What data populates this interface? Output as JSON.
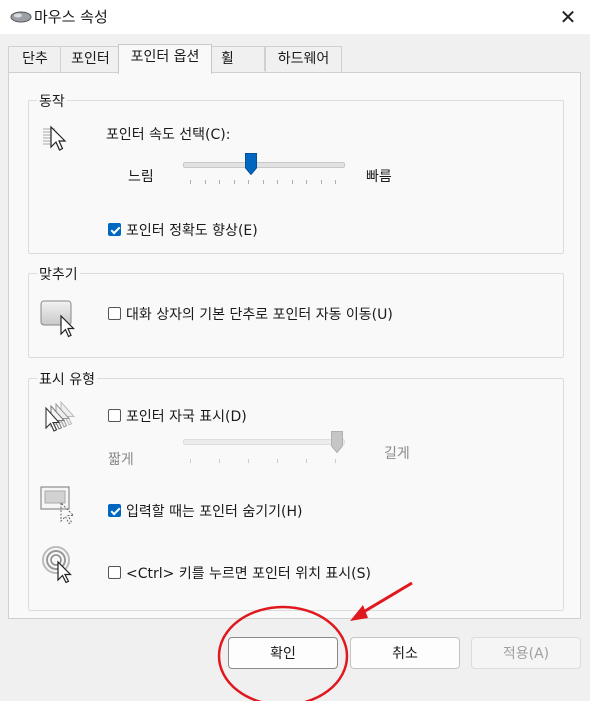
{
  "window": {
    "title": "마우스 속성",
    "close_symbol": "✕"
  },
  "tabs": [
    {
      "label": "단추"
    },
    {
      "label": "포인터"
    },
    {
      "label": "포인터 옵션"
    },
    {
      "label": "휠"
    },
    {
      "label": "하드웨어"
    }
  ],
  "active_tab": "포인터 옵션",
  "motion": {
    "group_title": "동작",
    "speed_label": "포인터 속도 선택(C):",
    "slow_label": "느림",
    "fast_label": "빠름",
    "speed_level": 0.42,
    "precision_label": "포인터 정확도 향상(E)",
    "precision_checked": true
  },
  "snap_to": {
    "group_title": "맞추기",
    "label": "대화 상자의 기본 단추로 포인터 자동 이동(U)",
    "checked": false
  },
  "visibility": {
    "group_title": "표시 유형",
    "trails_label": "포인터 자국 표시(D)",
    "trails_checked": false,
    "short_label": "짧게",
    "long_label": "길게",
    "trail_level": 1.0,
    "hide_typing_label": "입력할 때는 포인터 숨기기(H)",
    "hide_typing_checked": true,
    "ctrl_label": "<Ctrl> 키를 누르면 포인터 위치 표시(S)",
    "ctrl_checked": false
  },
  "buttons": {
    "ok": "확인",
    "cancel": "취소",
    "apply": "적용(A)"
  },
  "colors": {
    "accent": "#0067c0",
    "annotation": "#e0191e"
  },
  "icons": {
    "title": "mouse-icon",
    "speed": "pointer-speed-icon",
    "snap": "snap-to-default-icon",
    "trails": "pointer-trails-icon",
    "hide": "hide-pointer-icon",
    "ctrl": "ctrl-locate-icon"
  }
}
